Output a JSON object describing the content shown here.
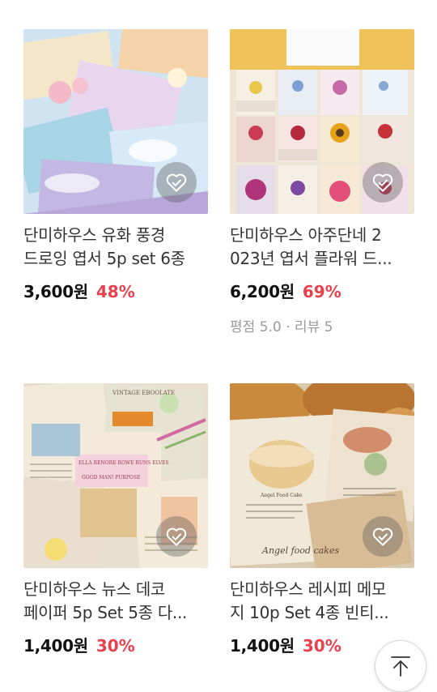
{
  "products": [
    {
      "title_line1": "단미하우스 유화 풍경",
      "title_line2": "드로잉 엽서 5p set 6종",
      "price": "3,600원",
      "discount": "48%"
    },
    {
      "title_line1": "단미하우스 아주단네 2",
      "title_line2": "023년 엽서 플라워 드...",
      "price": "6,200원",
      "discount": "69%",
      "rating": "평점 5.0 · 리뷰 5"
    },
    {
      "title_line1": "단미하우스 뉴스 데코",
      "title_line2": "페이퍼 5p Set 5종 다...",
      "price": "1,400원",
      "discount": "30%",
      "thumb_text": [
        "VINTAGE EBOOLATE",
        "ELLA RENORE ROWE RUNS ELVES",
        "GOOD MAN! PURPOSE"
      ]
    },
    {
      "title_line1": "단미하우스 레시피 메모",
      "title_line2": "지 10p Set 4종 빈티...",
      "price": "1,400원",
      "discount": "30%",
      "thumb_text": [
        "Angel Food Cake",
        "Angel food cakes"
      ]
    }
  ],
  "icons": {
    "wishlist": "heart-outline-icon",
    "scroll_top": "arrow-up-icon"
  },
  "colors": {
    "discount": "#e8414d",
    "price": "#111111",
    "rating": "#9a9a9a"
  }
}
